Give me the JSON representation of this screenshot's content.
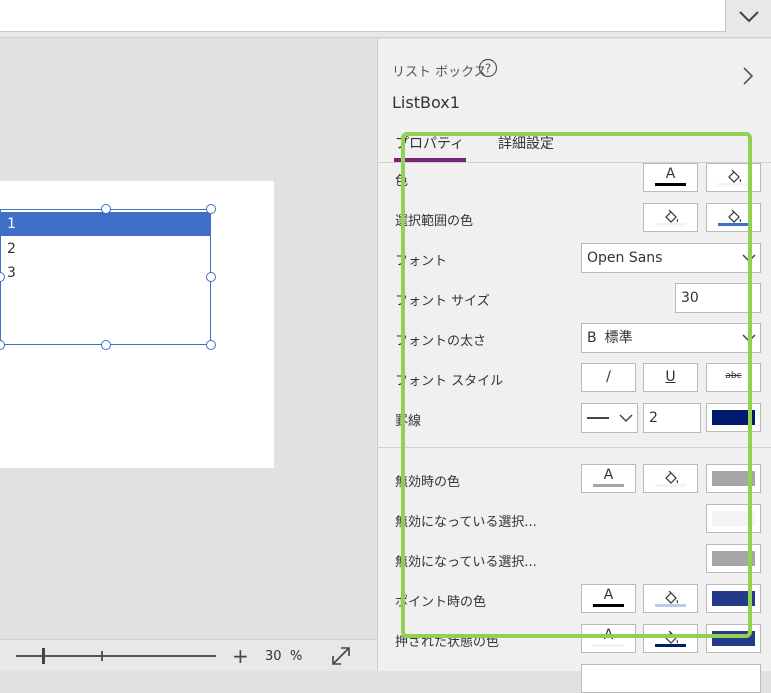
{
  "panel": {
    "control_type": "リスト ボックス",
    "control_name": "ListBox1",
    "tabs": [
      {
        "label": "プロパティ",
        "active": true
      },
      {
        "label": "詳細設定",
        "active": false
      }
    ],
    "properties": {
      "color_label": "色",
      "selection_color_label": "選択範囲の色",
      "font_label": "フォント",
      "font_value": "Open Sans",
      "font_size_label": "フォント サイズ",
      "font_size_value": "30",
      "font_weight_label": "フォントの太さ",
      "font_weight_value": "標準",
      "font_weight_glyph": "B",
      "font_style_label": "フォント スタイル",
      "italic_glyph": "/",
      "underline_glyph": "U",
      "strike_glyph": "abc",
      "border_label": "罫線",
      "border_width_value": "2",
      "disabled_color_label": "無効時の色",
      "disabled_selection1_label": "無効になっている選択...",
      "disabled_selection2_label": "無効になっている選択...",
      "hover_color_label": "ポイント時の色",
      "pressed_color_label": "押された状態の色",
      "text_glyph": "A"
    }
  },
  "canvas": {
    "list_items": [
      "1",
      "2",
      "3"
    ]
  },
  "zoom": {
    "plus": "+",
    "value": "30",
    "unit": "%",
    "level_fraction": 0.3
  },
  "colors": {
    "accent_tab": "#742774",
    "selection_blue": "#3f6fc8",
    "border_color": "#001a6e",
    "highlight_frame": "#92d050",
    "disabled_gray": "#a6a6a6",
    "hover_fill": "#233a8b"
  },
  "icons": {
    "help": "help-icon",
    "collapse": "chevron-down-icon",
    "expand": "chevron-right-icon",
    "fill": "paint-bucket-icon",
    "fullscreen": "expand-arrows-icon"
  }
}
